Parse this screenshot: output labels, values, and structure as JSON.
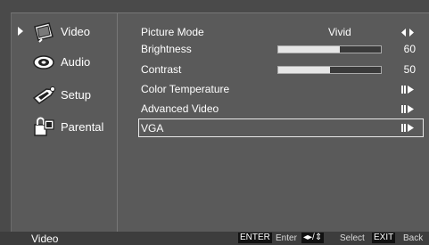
{
  "sidebar": {
    "items": [
      {
        "label": "Video",
        "icon": "monitor-icon"
      },
      {
        "label": "Audio",
        "icon": "speaker-icon"
      },
      {
        "label": "Setup",
        "icon": "wrench-icon"
      },
      {
        "label": "Parental",
        "icon": "lock-icon"
      }
    ]
  },
  "menu": {
    "picture_mode": {
      "label": "Picture Mode",
      "value": "Vivid"
    },
    "brightness": {
      "label": "Brightness",
      "value": "60",
      "level": 0.6
    },
    "contrast": {
      "label": "Contrast",
      "value": "50",
      "level": 0.5
    },
    "color_temperature": {
      "label": "Color Temperature"
    },
    "advanced_video": {
      "label": "Advanced Video"
    },
    "vga": {
      "label": "VGA"
    }
  },
  "footer": {
    "section": "Video",
    "enter_key": "ENTER",
    "enter_label": "Enter",
    "nav_key": "◂▸/⇕",
    "select_label": "Select",
    "exit_key": "EXIT",
    "back_label": "Back"
  },
  "colors": {
    "panel": "#5a5a5a",
    "text": "#ffffff",
    "highlight_border": "#e8e8e8"
  }
}
